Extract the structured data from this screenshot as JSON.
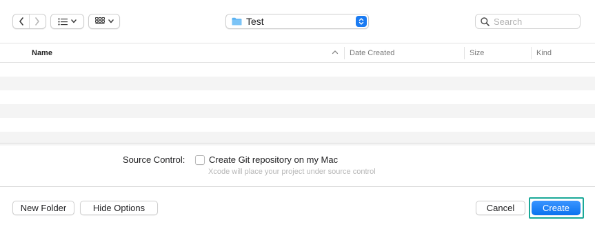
{
  "toolbar": {
    "back_icon": "chevron-left-icon",
    "forward_icon": "chevron-right-icon",
    "list_view_icon": "list-view-icon",
    "grid_view_icon": "grid-view-icon",
    "location": "Test",
    "search_placeholder": "Search"
  },
  "list": {
    "columns": [
      "Name",
      "Date Created",
      "Size",
      "Kind"
    ],
    "sort_column": "Name",
    "sort_direction": "ascending",
    "rows": []
  },
  "accessory": {
    "source_control_label": "Source Control:",
    "git_checkbox_label": "Create Git repository on my Mac",
    "git_checkbox_checked": false,
    "hint": "Xcode will place your project under source control"
  },
  "footer": {
    "new_folder": "New Folder",
    "hide_options": "Hide Options",
    "cancel": "Cancel",
    "create": "Create"
  },
  "colors": {
    "accent": "#0a72ef",
    "focus_ring": "#1aa898",
    "row_stripe": "#f4f4f4"
  }
}
